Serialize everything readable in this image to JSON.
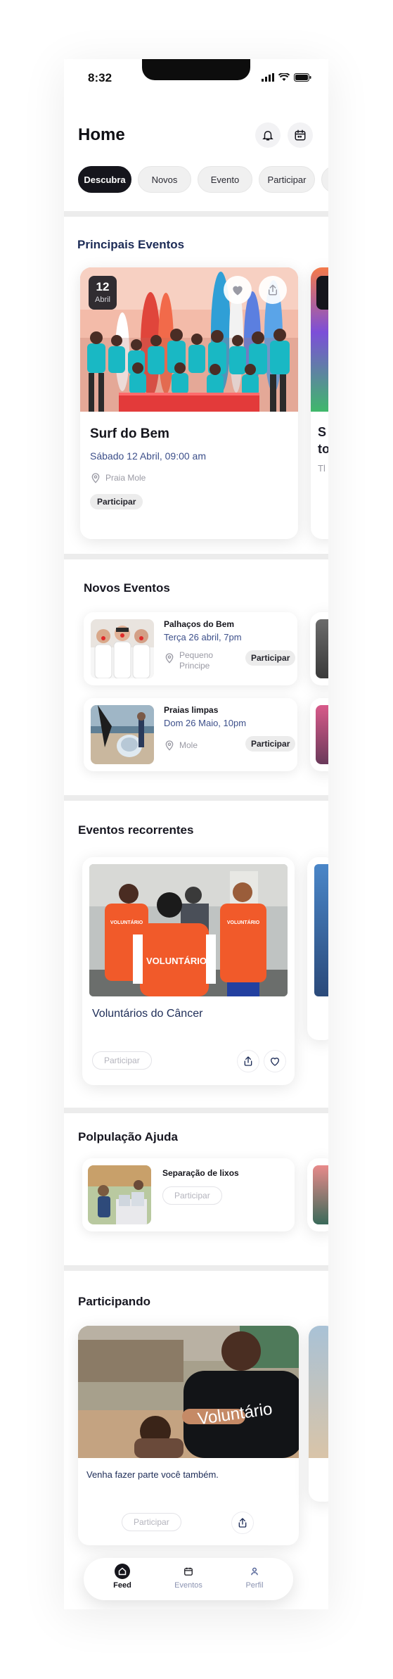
{
  "status": {
    "time": "8:32"
  },
  "header": {
    "title": "Home"
  },
  "chips": [
    "Descubra",
    "Novos",
    "Evento",
    "Participar"
  ],
  "principais": {
    "title": "Principais Eventos",
    "card": {
      "day": "12",
      "month": "Abril",
      "title": "Surf do Bem",
      "when": "Sábado 12 Abril, 09:00 am",
      "location": "Praia Mole",
      "action": "Participar"
    },
    "peek": {
      "title_a": "S",
      "title_b": "to",
      "sub": "Tl"
    }
  },
  "novos": {
    "title": "Novos Eventos",
    "items": [
      {
        "title": "Palhaços do Bem",
        "when": "Terça 26 abril, 7pm",
        "loc1": "Pequeno",
        "loc2": "Principe",
        "action": "Participar"
      },
      {
        "title": "Praias limpas",
        "when": "Dom 26 Maio, 10pm",
        "loc1": "Mole",
        "loc2": "",
        "action": "Participar"
      }
    ]
  },
  "recorrentes": {
    "title": "Eventos recorrentes",
    "card": {
      "title": "Voluntários do Câncer",
      "action": "Participar",
      "vest_text": "VOLUNTÁRIO",
      "vest_small": "VOLUNTÁRIO"
    }
  },
  "populacao": {
    "title": "Polpulação Ajuda",
    "card": {
      "title": "Separação de lixos",
      "action": "Participar"
    }
  },
  "participando": {
    "title": "Participando",
    "card": {
      "caption": "Venha fazer parte você também.",
      "action": "Participar",
      "shirt_text": "Voluntário"
    }
  },
  "nav": {
    "feed": "Feed",
    "eventos": "Eventos",
    "perfil": "Perfil"
  },
  "colors": {
    "dark": "#15151c",
    "navy": "#3c4f8a",
    "nav_inactive": "#8b93b1"
  }
}
